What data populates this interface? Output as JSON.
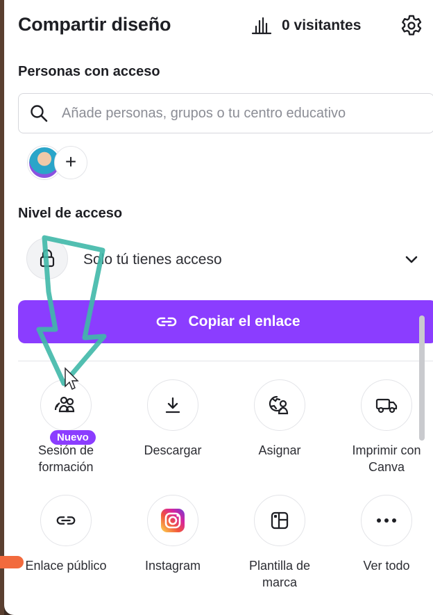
{
  "header": {
    "title": "Compartir diseño",
    "visitors": "0 visitantes"
  },
  "people_access": {
    "label": "Personas con acceso",
    "search_placeholder": "Añade personas, grupos o tu centro educativo",
    "add_symbol": "+"
  },
  "access_level": {
    "label": "Nivel de acceso",
    "value": "Solo tú tienes acceso"
  },
  "copy_link": {
    "label": "Copiar el enlace"
  },
  "actions": [
    {
      "label": "Sesión de\nformación",
      "icon": "training-session-icon",
      "badge": "Nuevo"
    },
    {
      "label": "Descargar",
      "icon": "download-icon"
    },
    {
      "label": "Asignar",
      "icon": "assign-icon"
    },
    {
      "label": "Imprimir con\nCanva",
      "icon": "truck-icon"
    },
    {
      "label": "Enlace público",
      "icon": "link-icon"
    },
    {
      "label": "Instagram",
      "icon": "instagram-icon"
    },
    {
      "label": "Plantilla de\nmarca",
      "icon": "brand-template-icon"
    },
    {
      "label": "Ver todo",
      "icon": "more-icon"
    }
  ],
  "colors": {
    "accent": "#8b3dff",
    "annotation_arrow": "#3fb8a8"
  }
}
